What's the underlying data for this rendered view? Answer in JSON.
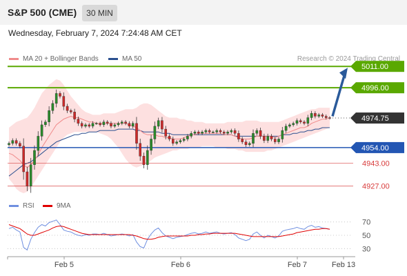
{
  "header": {
    "symbol": "S&P 500 (CME)",
    "timeframe": "30 MIN"
  },
  "datetime": "Wednesday, February 7, 2024 7:24:48 AM CET",
  "credit": "Research © 2024 Trading Central",
  "colors": {
    "resistance": "#5aa800",
    "pivot": "#2356b3",
    "support": "#d83b3b",
    "last": "#333333",
    "up_candle": "#2a8a2a",
    "down_candle": "#cc2a2a",
    "bollinger_fill": "#fde0e0",
    "ma20": "#f08a8a",
    "ma50": "#2a4f8f",
    "rsi": "#6f8fe0",
    "rsi_ma": "#e00000",
    "arrow": "#2a5a9a"
  },
  "chart_data": [
    {
      "type": "candlestick",
      "title": "S&P 500 (CME)",
      "legend": [
        {
          "name": "MA 20 + Bollinger Bands",
          "color": "#f08a8a"
        },
        {
          "name": "MA 50",
          "color": "#2a4f8f"
        }
      ],
      "x_ticks": [
        "Feb 5",
        "Feb 6",
        "Feb 7",
        "Feb 13"
      ],
      "ylim": [
        4922,
        5014
      ],
      "levels": [
        {
          "label": "5011.00",
          "value": 5011.0,
          "kind": "resistance"
        },
        {
          "label": "4996.00",
          "value": 4996.0,
          "kind": "resistance"
        },
        {
          "label": "4974.75",
          "value": 4974.75,
          "kind": "last"
        },
        {
          "label": "4954.00",
          "value": 4954.0,
          "kind": "pivot"
        },
        {
          "label": "4943.00",
          "value": 4943.0,
          "kind": "support"
        },
        {
          "label": "4927.00",
          "value": 4927.0,
          "kind": "support"
        }
      ],
      "close": [
        4957,
        4959,
        4957,
        4955,
        4937,
        4927,
        4942,
        4952,
        4962,
        4970,
        4972,
        4980,
        4985,
        4992,
        4990,
        4983,
        4980,
        4979,
        4974,
        4971,
        4969,
        4970,
        4969,
        4971,
        4971,
        4970,
        4972,
        4971,
        4969,
        4970,
        4971,
        4972,
        4971,
        4969,
        4971,
        4957,
        4948,
        4942,
        4952,
        4960,
        4969,
        4973,
        4967,
        4962,
        4960,
        4957,
        4958,
        4959,
        4960,
        4962,
        4964,
        4965,
        4964,
        4965,
        4966,
        4965,
        4965,
        4966,
        4965,
        4964,
        4965,
        4966,
        4964,
        4960,
        4958,
        4956,
        4957,
        4964,
        4966,
        4962,
        4959,
        4962,
        4960,
        4958,
        4960,
        4966,
        4969,
        4970,
        4971,
        4973,
        4972,
        4971,
        4975,
        4978,
        4976,
        4977,
        4976,
        4975,
        4974.75
      ],
      "ma20": [
        4950,
        4949,
        4947,
        4945,
        4942,
        4940,
        4942,
        4945,
        4949,
        4954,
        4958,
        4962,
        4966,
        4970,
        4972,
        4974,
        4975,
        4976,
        4975,
        4975,
        4974,
        4973,
        4972,
        4972,
        4971,
        4971,
        4971,
        4971,
        4971,
        4971,
        4971,
        4971,
        4971,
        4970,
        4969,
        4968,
        4966,
        4964,
        4963,
        4963,
        4963,
        4962,
        4962,
        4961,
        4961,
        4960,
        4960,
        4960,
        4961,
        4962,
        4963,
        4963,
        4964,
        4964,
        4964,
        4964,
        4964,
        4964,
        4964,
        4963,
        4963,
        4963,
        4962,
        4961,
        4960,
        4960,
        4960,
        4961,
        4962,
        4962,
        4962,
        4962,
        4962,
        4961,
        4962,
        4963,
        4964,
        4965,
        4966,
        4967,
        4968,
        4968,
        4969,
        4971,
        4972,
        4973,
        4974,
        4974,
        4975
      ],
      "ma50": [
        4934,
        4936,
        4938,
        4940,
        4942,
        4943,
        4944,
        4946,
        4948,
        4950,
        4952,
        4954,
        4956,
        4958,
        4959,
        4960,
        4961,
        4962,
        4963,
        4963,
        4964,
        4964,
        4965,
        4965,
        4965,
        4966,
        4966,
        4966,
        4966,
        4966,
        4967,
        4967,
        4967,
        4967,
        4967,
        4966,
        4966,
        4965,
        4965,
        4965,
        4965,
        4965,
        4964,
        4964,
        4964,
        4963,
        4963,
        4963,
        4963,
        4963,
        4963,
        4963,
        4963,
        4963,
        4963,
        4963,
        4963,
        4963,
        4963,
        4963,
        4963,
        4963,
        4962,
        4962,
        4962,
        4962,
        4962,
        4962,
        4962,
        4962,
        4962,
        4962,
        4962,
        4962,
        4962,
        4963,
        4963,
        4963,
        4964,
        4964,
        4965,
        4965,
        4966,
        4966,
        4967,
        4967,
        4968,
        4968,
        4968
      ],
      "bb_upper": [
        4968,
        4970,
        4972,
        4973,
        4974,
        4975,
        4978,
        4982,
        4987,
        4992,
        4995,
        4998,
        5000,
        5002,
        5001,
        4998,
        4994,
        4990,
        4987,
        4984,
        4981,
        4979,
        4978,
        4977,
        4977,
        4977,
        4978,
        4978,
        4978,
        4978,
        4979,
        4980,
        4981,
        4981,
        4981,
        4982,
        4984,
        4985,
        4985,
        4984,
        4982,
        4980,
        4978,
        4976,
        4975,
        4975,
        4975,
        4974,
        4974,
        4973,
        4973,
        4972,
        4972,
        4972,
        4971,
        4971,
        4971,
        4971,
        4971,
        4971,
        4972,
        4972,
        4972,
        4972,
        4972,
        4973,
        4973,
        4973,
        4973,
        4972,
        4972,
        4972,
        4972,
        4972,
        4972,
        4973,
        4974,
        4975,
        4976,
        4977,
        4978,
        4979,
        4980,
        4981,
        4981,
        4982,
        4982,
        4982,
        4982
      ],
      "bb_lower": [
        4932,
        4929,
        4925,
        4923,
        4922,
        4923,
        4926,
        4930,
        4934,
        4938,
        4942,
        4946,
        4950,
        4954,
        4958,
        4961,
        4963,
        4964,
        4965,
        4965,
        4965,
        4965,
        4965,
        4965,
        4965,
        4964,
        4963,
        4962,
        4960,
        4957,
        4954,
        4950,
        4946,
        4943,
        4941,
        4940,
        4941,
        4942,
        4943,
        4945,
        4947,
        4948,
        4949,
        4950,
        4951,
        4952,
        4952,
        4953,
        4953,
        4953,
        4954,
        4954,
        4954,
        4955,
        4955,
        4955,
        4955,
        4954,
        4954,
        4954,
        4953,
        4953,
        4953,
        4952,
        4952,
        4951,
        4951,
        4951,
        4951,
        4951,
        4951,
        4952,
        4952,
        4953,
        4954,
        4955,
        4956,
        4957,
        4958,
        4959,
        4960,
        4961,
        4962,
        4963,
        4964,
        4965,
        4966,
        4967,
        4968
      ],
      "forecast_arrow": {
        "from": 4976,
        "to": 5011
      }
    },
    {
      "type": "line",
      "title": "RSI",
      "legend": [
        {
          "name": "RSI",
          "color": "#6f8fe0"
        },
        {
          "name": "9MA",
          "color": "#e00000"
        }
      ],
      "yticks": [
        30,
        50,
        70
      ],
      "rsi": [
        60,
        62,
        58,
        55,
        32,
        28,
        44,
        54,
        62,
        66,
        64,
        69,
        71,
        73,
        66,
        58,
        56,
        55,
        52,
        50,
        49,
        51,
        50,
        52,
        52,
        51,
        53,
        51,
        49,
        50,
        51,
        52,
        51,
        49,
        51,
        40,
        33,
        31,
        44,
        52,
        58,
        61,
        54,
        49,
        47,
        45,
        47,
        48,
        49,
        51,
        53,
        54,
        52,
        53,
        55,
        53,
        54,
        55,
        53,
        52,
        53,
        54,
        51,
        46,
        44,
        42,
        44,
        52,
        55,
        50,
        46,
        50,
        48,
        46,
        49,
        56,
        58,
        59,
        60,
        62,
        60,
        59,
        63,
        65,
        62,
        63,
        61,
        60,
        59
      ],
      "rsi_ma": [
        66,
        64,
        62,
        60,
        56,
        52,
        50,
        50,
        52,
        54,
        56,
        58,
        61,
        63,
        64,
        63,
        61,
        59,
        57,
        55,
        53,
        52,
        51,
        51,
        51,
        51,
        51,
        51,
        51,
        51,
        51,
        51,
        51,
        51,
        50,
        49,
        47,
        45,
        44,
        44,
        45,
        47,
        48,
        49,
        49,
        49,
        49,
        49,
        49,
        49,
        50,
        50,
        51,
        51,
        52,
        52,
        53,
        53,
        53,
        53,
        53,
        53,
        53,
        52,
        51,
        50,
        49,
        48,
        48,
        48,
        48,
        48,
        48,
        48,
        48,
        49,
        50,
        51,
        52,
        54,
        55,
        56,
        57,
        58,
        59,
        59,
        60,
        60,
        59
      ]
    }
  ]
}
